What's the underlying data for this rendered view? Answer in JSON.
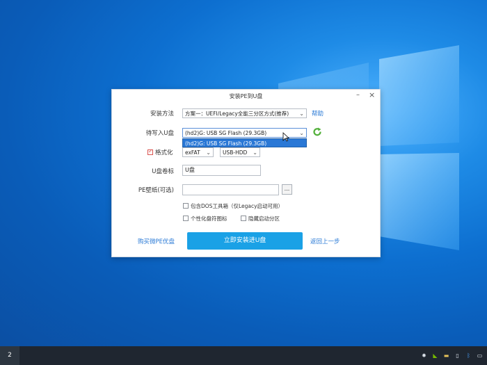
{
  "dialog": {
    "title": "安装PE到U盘",
    "minimize_glyph": "–",
    "close_glyph": "×",
    "install_method_label": "安装方法",
    "install_method_value": "方案一：UEFI/Legacy全能三分区方式(推荐)",
    "help_link": "帮助",
    "target_disk_label": "待写入U盘",
    "target_disk_value": "(hd2)G: USB SG Flash (29.3GB)",
    "target_disk_options": [
      "(hd2)G: USB SG Flash (29.3GB)"
    ],
    "format_label": "格式化",
    "format_checked": true,
    "fs_value": "exFAT",
    "mode_value": "USB-HDD",
    "volume_label_label": "U盘卷标",
    "volume_label_value": "U盘",
    "wallpaper_label": "PE壁纸(可选)",
    "wallpaper_value": "",
    "browse_label": "...",
    "option_dos": "包含DOS工具箱（仅Legacy启动可用）",
    "option_icon": "个性化盘符图标",
    "option_hide": "隐藏启动分区",
    "buy_link": "购买微PE优盘",
    "install_button": "立即安装进U盘",
    "back_link": "返回上一步"
  },
  "taskbar": {
    "start_label": "2",
    "tray_icons": [
      "settings-icon",
      "nvidia-icon",
      "folder-icon",
      "usb-icon",
      "bluetooth-icon",
      "network-icon"
    ]
  },
  "colors": {
    "desktop": "#0d6fd0",
    "accent": "#1aa1e6",
    "link": "#2a7ad6",
    "selected": "#2a78d6",
    "refresh": "#52b03a"
  }
}
